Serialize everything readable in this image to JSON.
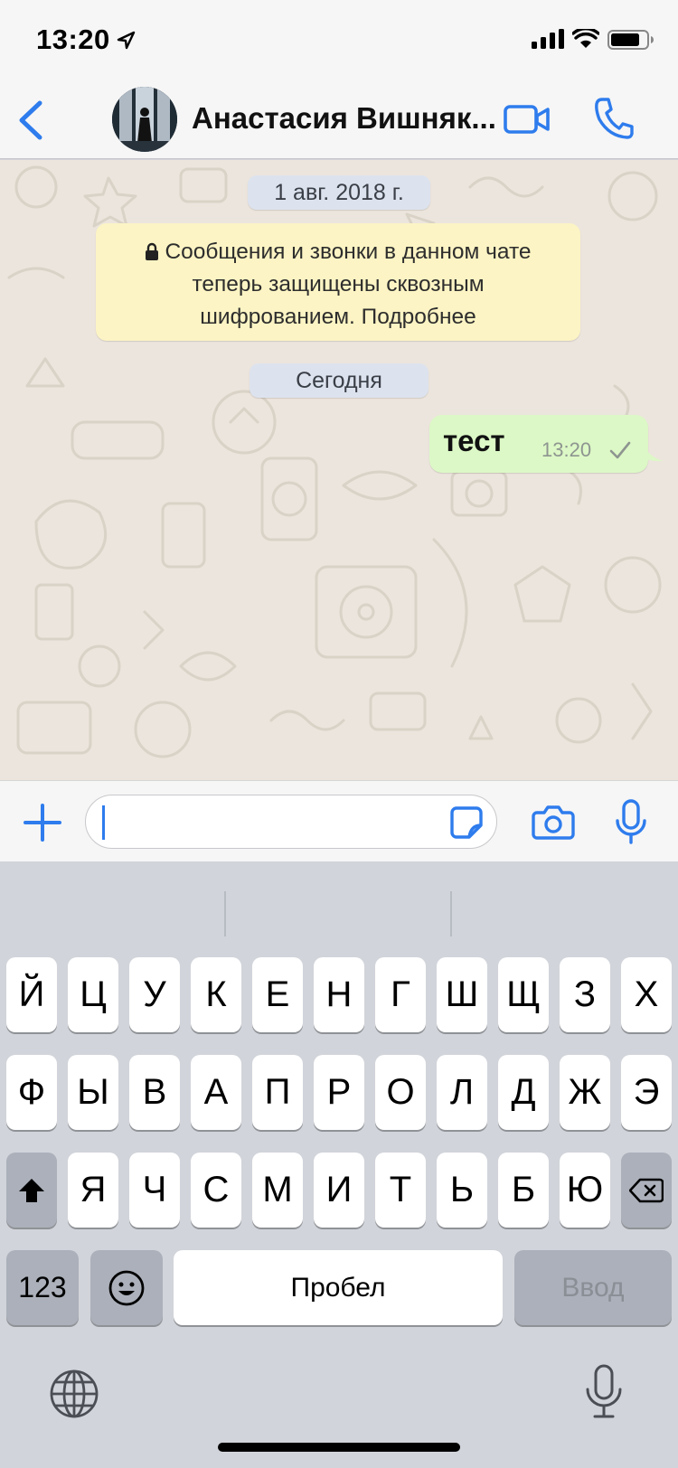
{
  "status_bar": {
    "time": "13:20",
    "icons": [
      "location-arrow-icon",
      "cellular-signal-icon",
      "wifi-icon",
      "battery-icon"
    ]
  },
  "header": {
    "contact_name": "Анастасия Вишняк...",
    "icons": [
      "back-chevron-icon",
      "video-call-icon",
      "phone-call-icon"
    ],
    "accent_color": "#2e7ced"
  },
  "chat": {
    "date_separators": [
      "1 авг. 2018 г.",
      "Сегодня"
    ],
    "encryption_notice": {
      "line1": "Сообщения и звонки в данном чате",
      "line2": "теперь защищены сквозным",
      "line3": "шифрованием. Подробнее",
      "background": "#fcf4c4"
    },
    "messages": [
      {
        "direction": "outgoing",
        "text": "тест",
        "time": "13:20",
        "status": "sent",
        "bubble_color": "#dcf8c6"
      }
    ]
  },
  "composer": {
    "value": "",
    "icons": [
      "plus-icon",
      "sticker-icon",
      "camera-icon",
      "microphone-icon"
    ]
  },
  "keyboard": {
    "row1": [
      "Й",
      "Ц",
      "У",
      "К",
      "Е",
      "Н",
      "Г",
      "Ш",
      "Щ",
      "З",
      "Х"
    ],
    "row2": [
      "Ф",
      "Ы",
      "В",
      "А",
      "П",
      "Р",
      "О",
      "Л",
      "Д",
      "Ж",
      "Э"
    ],
    "row3": [
      "Я",
      "Ч",
      "С",
      "М",
      "И",
      "Т",
      "Ь",
      "Б",
      "Ю"
    ],
    "numbers_label": "123",
    "space_label": "Пробел",
    "enter_label": "Ввод",
    "icons": [
      "shift-icon",
      "backspace-icon",
      "emoji-icon",
      "globe-icon",
      "dictation-mic-icon"
    ]
  }
}
